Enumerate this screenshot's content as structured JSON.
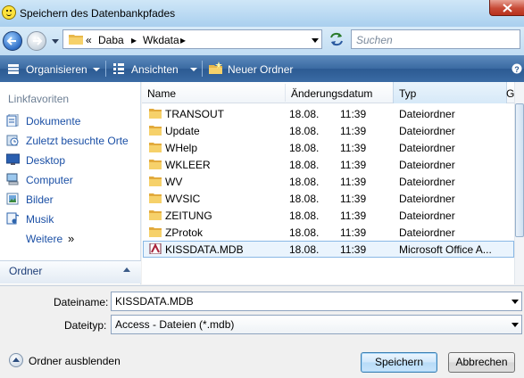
{
  "window": {
    "title": "Speichern des Datenbankpfades"
  },
  "address": {
    "prefix": "«",
    "breadcrumbs": [
      "Daba",
      "Wkdata"
    ],
    "separator": "▸"
  },
  "search": {
    "placeholder": "Suchen"
  },
  "toolbar": {
    "organize_label": "Organisieren",
    "views_label": "Ansichten",
    "new_folder_label": "Neuer Ordner"
  },
  "sidebar": {
    "heading": "Linkfavoriten",
    "items": [
      {
        "label": "Dokumente",
        "icon": "documents-icon"
      },
      {
        "label": "Zuletzt besuchte Orte",
        "icon": "recent-places-icon"
      },
      {
        "label": "Desktop",
        "icon": "desktop-icon"
      },
      {
        "label": "Computer",
        "icon": "computer-icon"
      },
      {
        "label": "Bilder",
        "icon": "pictures-icon"
      },
      {
        "label": "Musik",
        "icon": "music-icon"
      }
    ],
    "more_label": "Weitere",
    "more_glyph": "»",
    "folders_label": "Ordner"
  },
  "filelist": {
    "columns": {
      "name": "Name",
      "date": "Änderungsdatum",
      "type": "Typ",
      "size": "G"
    },
    "rows": [
      {
        "name": "TRANSOUT",
        "date": "18.08.",
        "time": "11:39",
        "type": "Dateiordner"
      },
      {
        "name": "Update",
        "date": "18.08.",
        "time": "11:39",
        "type": "Dateiordner"
      },
      {
        "name": "WHelp",
        "date": "18.08.",
        "time": "11:39",
        "type": "Dateiordner"
      },
      {
        "name": "WKLEER",
        "date": "18.08.",
        "time": "11:39",
        "type": "Dateiordner"
      },
      {
        "name": "WV",
        "date": "18.08.",
        "time": "11:39",
        "type": "Dateiordner"
      },
      {
        "name": "WVSIC",
        "date": "18.08.",
        "time": "11:39",
        "type": "Dateiordner"
      },
      {
        "name": "ZEITUNG",
        "date": "18.08.",
        "time": "11:39",
        "type": "Dateiordner"
      },
      {
        "name": "ZProtok",
        "date": "18.08.",
        "time": "11:39",
        "type": "Dateiordner"
      },
      {
        "name": "KISSDATA.MDB",
        "date": "18.08.",
        "time": "11:39",
        "type": "Microsoft Office A..."
      }
    ]
  },
  "form": {
    "filename_label": "Dateiname:",
    "filename_value": "KISSDATA.MDB",
    "filetype_label": "Dateityp:",
    "filetype_value": "Access - Dateien (*.mdb)"
  },
  "footer": {
    "hide_folders_label": "Ordner ausblenden",
    "save_label": "Speichern",
    "cancel_label": "Abbrechen"
  },
  "colors": {
    "accent": "#1a4fa5",
    "toolbar": "#3a6aa2",
    "selection": "#eaf4fd"
  }
}
